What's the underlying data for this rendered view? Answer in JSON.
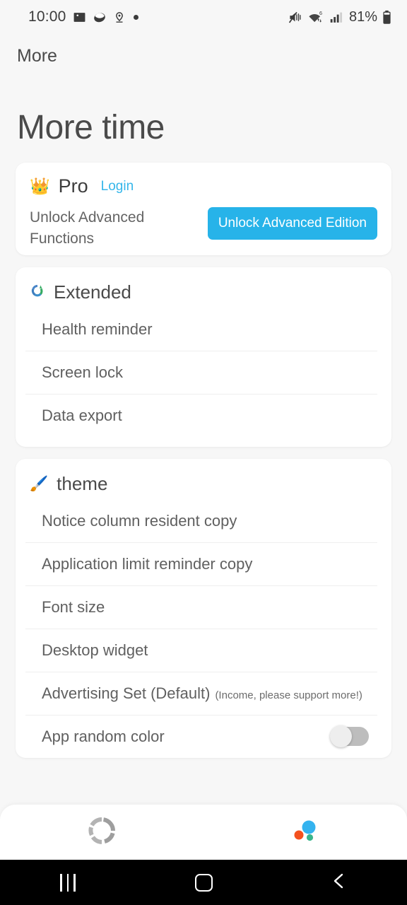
{
  "status_bar": {
    "time": "10:00",
    "left_icons": [
      "image-icon",
      "cookie-icon",
      "location-pin-icon",
      "dot-icon"
    ],
    "right_icons": [
      "mute-icon",
      "wifi-6-icon",
      "cellular-signal-icon"
    ],
    "battery_percent": "81%",
    "battery_icon": "battery-icon"
  },
  "toolbar": {
    "title": "More"
  },
  "page": {
    "title": "More time"
  },
  "pro_card": {
    "icon": "crown-icon",
    "title": "Pro",
    "login_label": "Login",
    "description": "Unlock Advanced Functions",
    "button_label": "Unlock Advanced Edition",
    "button_color": "#27b3e9",
    "login_color": "#35b6ea"
  },
  "extended_card": {
    "icon": "recycle-circle-icon",
    "title": "Extended",
    "items": [
      {
        "label": "Health reminder"
      },
      {
        "label": "Screen lock"
      },
      {
        "label": "Data export"
      }
    ]
  },
  "theme_card": {
    "icon": "paintbrush-icon",
    "title": "theme",
    "items": [
      {
        "label": "Notice column resident copy",
        "note": "",
        "toggle": null
      },
      {
        "label": "Application limit reminder copy",
        "note": "",
        "toggle": null
      },
      {
        "label": "Font size",
        "note": "",
        "toggle": null
      },
      {
        "label": "Desktop widget",
        "note": "",
        "toggle": null
      },
      {
        "label": "Advertising Set (Default)",
        "note": "(Income, please support more!)",
        "toggle": null
      },
      {
        "label": "App random color",
        "note": "",
        "toggle": "off"
      }
    ]
  },
  "tabbar": {
    "tabs": [
      {
        "name": "segmented-ring-icon",
        "active": false
      },
      {
        "name": "color-bubbles-icon",
        "active": true
      }
    ]
  },
  "android_nav": {
    "buttons": [
      "recents-icon",
      "home-icon",
      "back-icon"
    ]
  }
}
